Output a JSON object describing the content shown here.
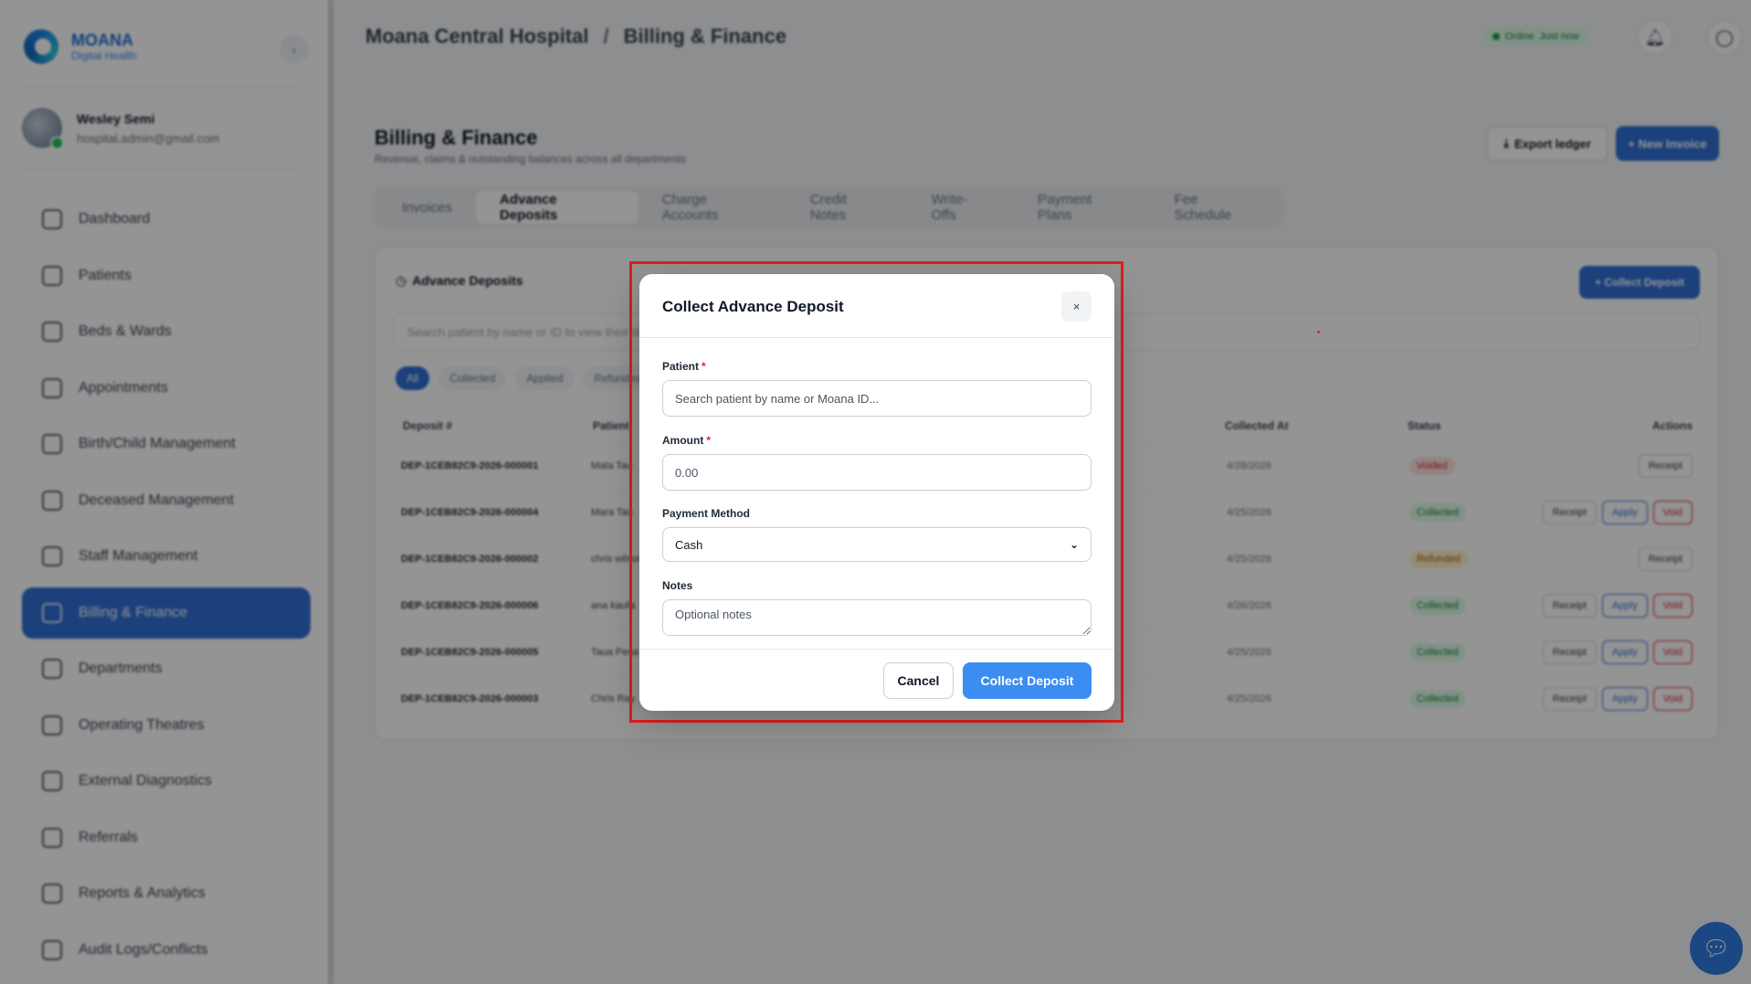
{
  "brand": {
    "name": "MOANA",
    "tagline": "Digital Health"
  },
  "user": {
    "name": "Wesley Semi",
    "email": "hospital.admin@gmail.com"
  },
  "sidebar": {
    "items": [
      {
        "label": "Dashboard",
        "icon": "grid-icon"
      },
      {
        "label": "Patients",
        "icon": "patients-icon"
      },
      {
        "label": "Beds & Wards",
        "icon": "bed-icon"
      },
      {
        "label": "Appointments",
        "icon": "calendar-icon"
      },
      {
        "label": "Birth/Child Management",
        "icon": "baby-icon"
      },
      {
        "label": "Deceased Management",
        "icon": "deceased-icon"
      },
      {
        "label": "Staff Management",
        "icon": "staff-icon"
      },
      {
        "label": "Billing & Finance",
        "icon": "billing-icon",
        "active": true
      },
      {
        "label": "Departments",
        "icon": "departments-icon"
      },
      {
        "label": "Operating Theatres",
        "icon": "theatre-icon"
      },
      {
        "label": "External Diagnostics",
        "icon": "diagnostics-icon"
      },
      {
        "label": "Referrals",
        "icon": "referrals-icon"
      },
      {
        "label": "Reports & Analytics",
        "icon": "reports-icon"
      },
      {
        "label": "Audit Logs/Conflicts",
        "icon": "audit-icon"
      }
    ]
  },
  "header": {
    "breadcrumb": [
      "Moana Central Hospital",
      "Billing & Finance"
    ],
    "separator": "/",
    "status": "Online",
    "status_detail": "Just now"
  },
  "page": {
    "title": "Billing & Finance",
    "subtitle": "Revenue, claims & outstanding balances across all departments",
    "export_label": "Export ledger",
    "new_invoice_label": "+ New Invoice",
    "tabs": [
      "Invoices",
      "Advance Deposits",
      "Charge Accounts",
      "Credit Notes",
      "Write-Offs",
      "Payment Plans",
      "Fee Schedule"
    ],
    "active_tab": "Advance Deposits"
  },
  "deposits": {
    "title": "Advance Deposits",
    "collect_label": "+ Collect Deposit",
    "search_placeholder": "Search patient by name or ID to view their deposits",
    "filters": [
      "All",
      "Collected",
      "Applied",
      "Refunded"
    ],
    "columns": [
      "Deposit #",
      "Patient",
      "Collected At",
      "Status",
      "Actions"
    ],
    "rows": [
      {
        "id": "DEP-1CEB82C9-2026-000001",
        "patient": "Mata Tau",
        "date": "4/28/2026",
        "status": "Voided",
        "actions": [
          "Receipt"
        ]
      },
      {
        "id": "DEP-1CEB82C9-2026-000004",
        "patient": "Mara Tau",
        "date": "4/25/2026",
        "status": "Collected",
        "actions": [
          "Receipt",
          "Apply",
          "Void"
        ]
      },
      {
        "id": "DEP-1CEB82C9-2026-000002",
        "patient": "chris wilson",
        "date": "4/25/2026",
        "status": "Refunded",
        "actions": [
          "Receipt"
        ]
      },
      {
        "id": "DEP-1CEB82C9-2026-000006",
        "patient": "ana kaufa",
        "date": "4/26/2026",
        "status": "Collected",
        "actions": [
          "Receipt",
          "Apply",
          "Void"
        ]
      },
      {
        "id": "DEP-1CEB82C9-2026-000005",
        "patient": "Taua Pesa",
        "date": "4/25/2026",
        "status": "Collected",
        "actions": [
          "Receipt",
          "Apply",
          "Void"
        ]
      },
      {
        "id": "DEP-1CEB82C9-2026-000003",
        "patient": "Chris Ray",
        "date": "4/25/2026",
        "status": "Collected",
        "actions": [
          "Receipt",
          "Apply",
          "Void"
        ]
      }
    ]
  },
  "modal": {
    "title": "Collect Advance Deposit",
    "close_label": "×",
    "patient_label": "Patient",
    "patient_placeholder": "Search patient by name or Moana ID...",
    "patient_value": "",
    "amount_label": "Amount",
    "amount_placeholder": "0.00",
    "amount_value": "",
    "payment_method_label": "Payment Method",
    "payment_method_value": "Cash",
    "notes_label": "Notes",
    "notes_placeholder": "Optional notes",
    "required_marker": "*",
    "cancel_label": "Cancel",
    "submit_label": "Collect Deposit"
  },
  "colors": {
    "primary": "#3b8df2",
    "sidebar_active": "#2f6fd6",
    "highlight": "#e01e1e",
    "required": "#e11d48"
  }
}
